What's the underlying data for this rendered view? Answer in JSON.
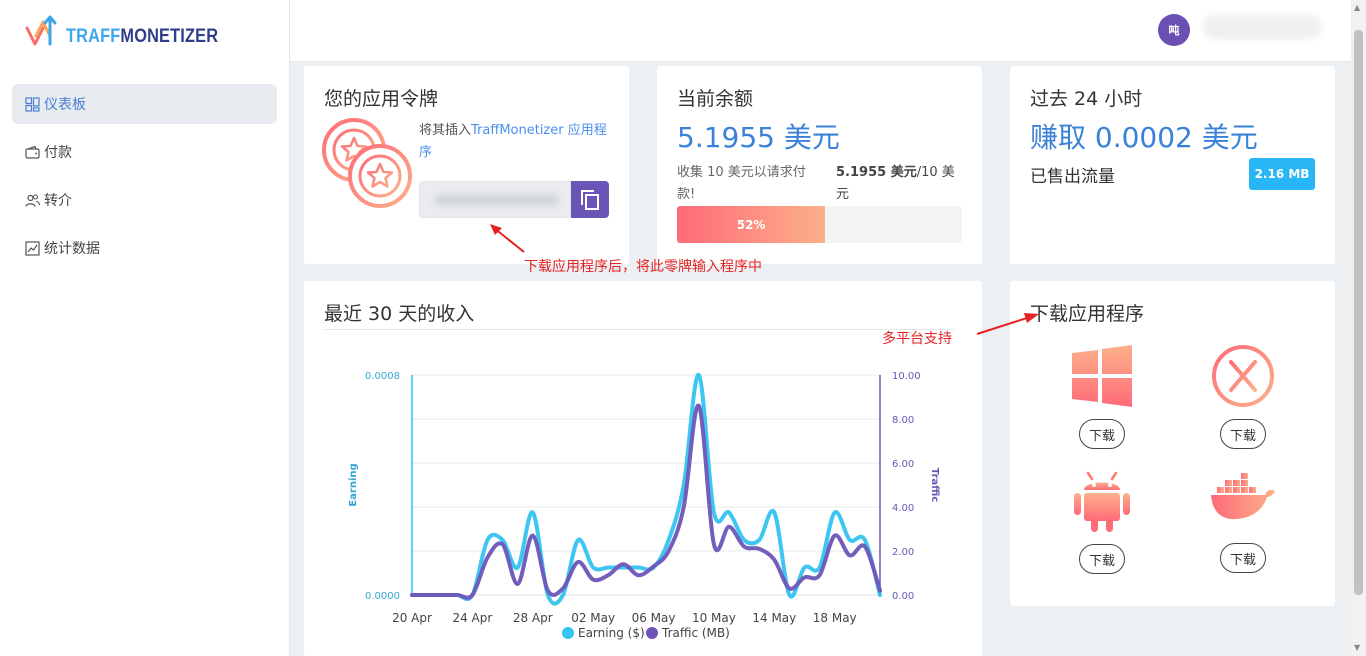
{
  "brand": {
    "part1": "TRAFF",
    "part2": "MONETIZER"
  },
  "nav": [
    {
      "label": "仪表板",
      "icon": "dashboard-icon",
      "active": true
    },
    {
      "label": "付款",
      "icon": "wallet-icon",
      "active": false
    },
    {
      "label": "转介",
      "icon": "users-icon",
      "active": false
    },
    {
      "label": "统计数据",
      "icon": "chart-icon",
      "active": false
    }
  ],
  "user": {
    "avatar_text": "吨"
  },
  "token": {
    "title": "您的应用令牌",
    "hint_prefix": "将其插入",
    "hint_link": "TraffMonetizer 应用程序"
  },
  "balance": {
    "title": "当前余额",
    "amount": "5.1955 美元",
    "note": "收集 10 美元以请求付款!",
    "progress_value": "5.1955 美元",
    "progress_target": "/10 美元",
    "progress_percent": 52,
    "progress_label": "52%"
  },
  "last24": {
    "title": "过去 24 小时",
    "earned": "赚取 0.0002 美元",
    "sold_label": "已售出流量",
    "sold_value": "2.16 MB"
  },
  "download": {
    "title": "下载应用程序",
    "buttons": [
      "下载",
      "下载",
      "下载",
      "下载"
    ],
    "platforms": [
      "windows-icon",
      "macos-icon",
      "android-icon",
      "docker-icon"
    ]
  },
  "annotations": {
    "token": "下载应用程序后，将此零牌输入程序中",
    "platforms": "多平台支持"
  },
  "colors": {
    "earning": "#33c3f0",
    "traffic": "#6d55b8",
    "accent": "#3a82d8",
    "brand_purple": "#6a55b8"
  },
  "chart_data": {
    "type": "line",
    "title": "最近 30 天的收入",
    "x_ticks": [
      "20 Apr",
      "24 Apr",
      "28 Apr",
      "02 May",
      "06 May",
      "10 May",
      "14 May",
      "18 May"
    ],
    "x": [
      "2023-04-20",
      "2023-04-21",
      "2023-04-22",
      "2023-04-23",
      "2023-04-24",
      "2023-04-25",
      "2023-04-26",
      "2023-04-27",
      "2023-04-28",
      "2023-04-29",
      "2023-04-30",
      "2023-05-01",
      "2023-05-02",
      "2023-05-03",
      "2023-05-04",
      "2023-05-05",
      "2023-05-06",
      "2023-05-07",
      "2023-05-08",
      "2023-05-09",
      "2023-05-10",
      "2023-05-11",
      "2023-05-12",
      "2023-05-13",
      "2023-05-14",
      "2023-05-15",
      "2023-05-16",
      "2023-05-17",
      "2023-05-18",
      "2023-05-19",
      "2023-05-20",
      "2023-05-21"
    ],
    "series": [
      {
        "name": "Earning ($)",
        "axis": "left",
        "color": "#33c3f0",
        "values": [
          0,
          0,
          0,
          0,
          0,
          0.0002,
          0.0002,
          0.0001,
          0.0003,
          0,
          0,
          0.0002,
          0.0001,
          0.0001,
          0.0001,
          0.0001,
          0.0001,
          0.0002,
          0.0004,
          0.0008,
          0.0003,
          0.0003,
          0.0002,
          0.0002,
          0.0003,
          0,
          0.0001,
          0.0001,
          0.0003,
          0.0002,
          0.0002,
          0
        ]
      },
      {
        "name": "Traffic (MB)",
        "axis": "right",
        "color": "#6d55b8",
        "values": [
          0,
          0,
          0,
          0,
          0,
          1.7,
          2.3,
          0.5,
          2.7,
          0.2,
          0.3,
          1.5,
          0.7,
          0.9,
          1.4,
          0.9,
          1.3,
          2.0,
          4.0,
          8.6,
          2.3,
          3.1,
          2.2,
          2.1,
          1.6,
          0.3,
          0.8,
          0.9,
          2.7,
          1.8,
          2.2,
          0.2
        ]
      }
    ],
    "y_left": {
      "label": "Earning",
      "min": 0,
      "max": 0.0008,
      "ticks": [
        "0.0000",
        "0.0008"
      ]
    },
    "y_right": {
      "label": "Traffic",
      "min": 0,
      "max": 10,
      "ticks": [
        "0.00",
        "2.00",
        "4.00",
        "6.00",
        "8.00",
        "10.00"
      ]
    },
    "legend": "bottom",
    "grid": true
  }
}
